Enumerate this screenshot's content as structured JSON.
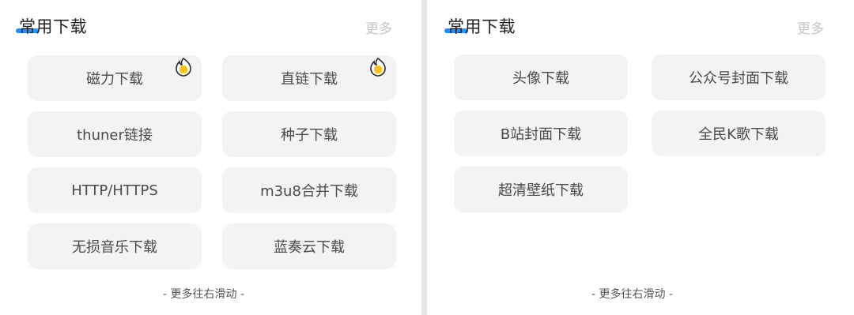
{
  "left_panel": {
    "title": "常用下载",
    "more": "更多",
    "buttons": [
      {
        "label": "磁力下载",
        "hot": true
      },
      {
        "label": "直链下载",
        "hot": true
      },
      {
        "label": "thuner链接",
        "hot": false
      },
      {
        "label": "种子下载",
        "hot": false
      },
      {
        "label": "HTTP/HTTPS",
        "hot": false
      },
      {
        "label": "m3u8合并下载",
        "hot": false
      },
      {
        "label": "无损音乐下载",
        "hot": false
      },
      {
        "label": "蓝奏云下载",
        "hot": false
      }
    ],
    "footer": "- 更多往右滑动 -"
  },
  "right_panel": {
    "title": "常用下载",
    "more": "更多",
    "buttons": [
      {
        "label": "头像下载"
      },
      {
        "label": "公众号封面下载"
      },
      {
        "label": "B站封面下载"
      },
      {
        "label": "全民K歌下载"
      },
      {
        "label": "超清壁纸下载"
      }
    ],
    "footer": "- 更多往右滑动 -"
  },
  "colors": {
    "accent": "#1e88ff",
    "hot_badge": "#ffc21a",
    "button_bg": "#f3f3f3"
  },
  "icons": {
    "hot": "flame-badge-icon"
  }
}
